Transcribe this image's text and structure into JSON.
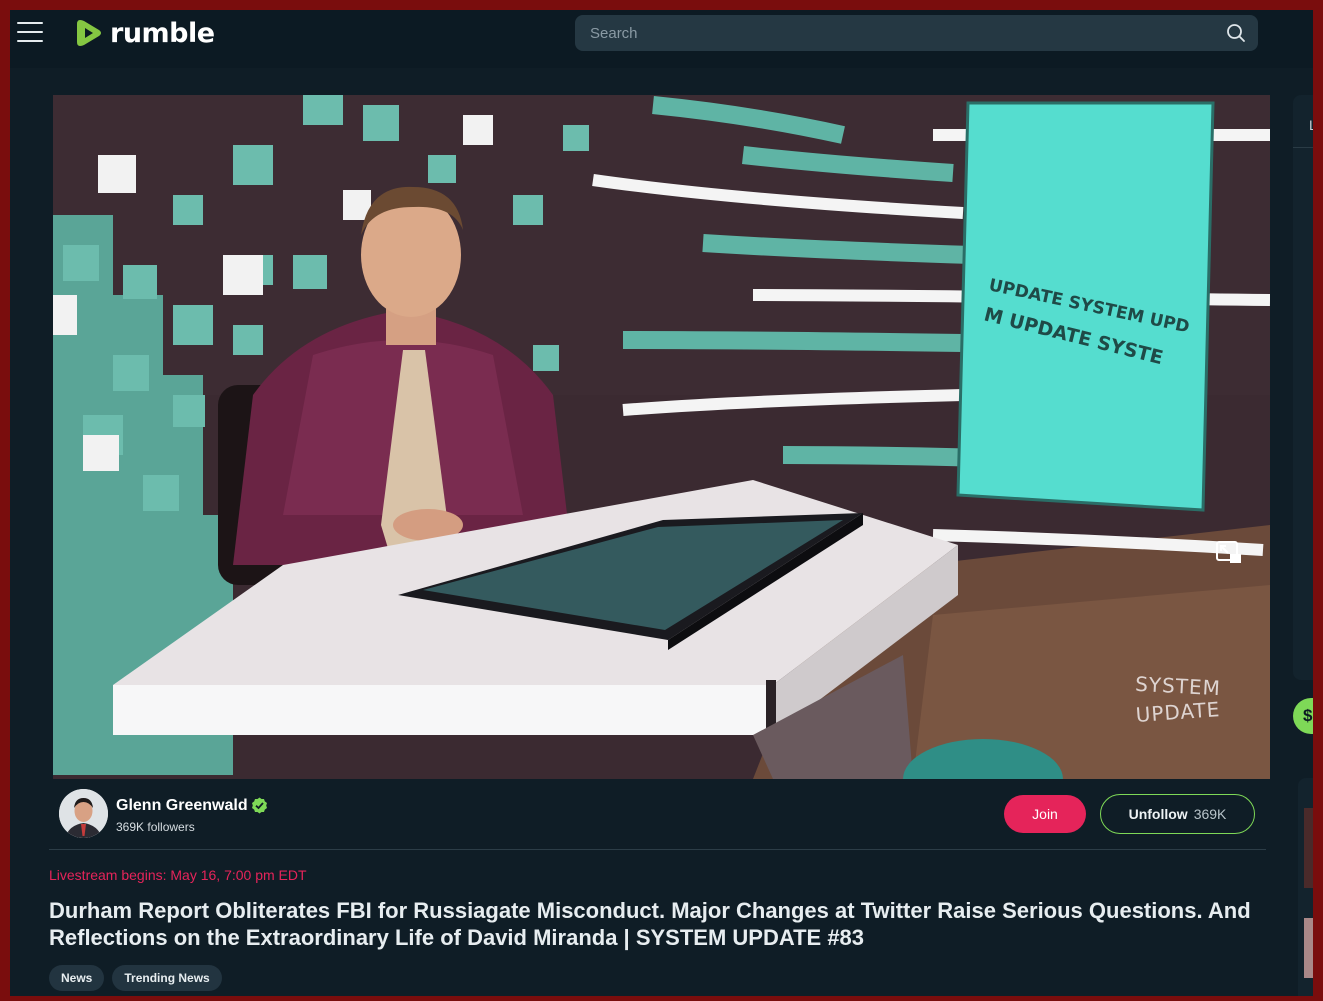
{
  "header": {
    "logo_text": "rumble",
    "search_placeholder": "Search"
  },
  "video": {
    "watermark_line1": "SYSTEM",
    "watermark_line2": "UPDATE",
    "screen_text_line1": "UPDATE SYSTEM UPD",
    "screen_text_line2": "M UPDATE SYSTE"
  },
  "channel": {
    "name": "Glenn Greenwald",
    "followers": "369K followers",
    "join_label": "Join",
    "unfollow_label": "Unfollow",
    "unfollow_count": "369K"
  },
  "info": {
    "livestream_text": "Livestream begins: May 16, 7:00 pm EDT",
    "title": "Durham Report Obliterates FBI for Russiagate Misconduct. Major Changes at Twitter Raise Serious Questions. And Reflections on the Extraordinary Life of David Miranda | SYSTEM UPDATE #83",
    "tags": [
      "News",
      "Trending News"
    ]
  },
  "side": {
    "letter": "L",
    "money_symbol": "$"
  },
  "colors": {
    "brand_green": "#7ed957",
    "join_red": "#e5245a",
    "background": "#0f1d26"
  }
}
